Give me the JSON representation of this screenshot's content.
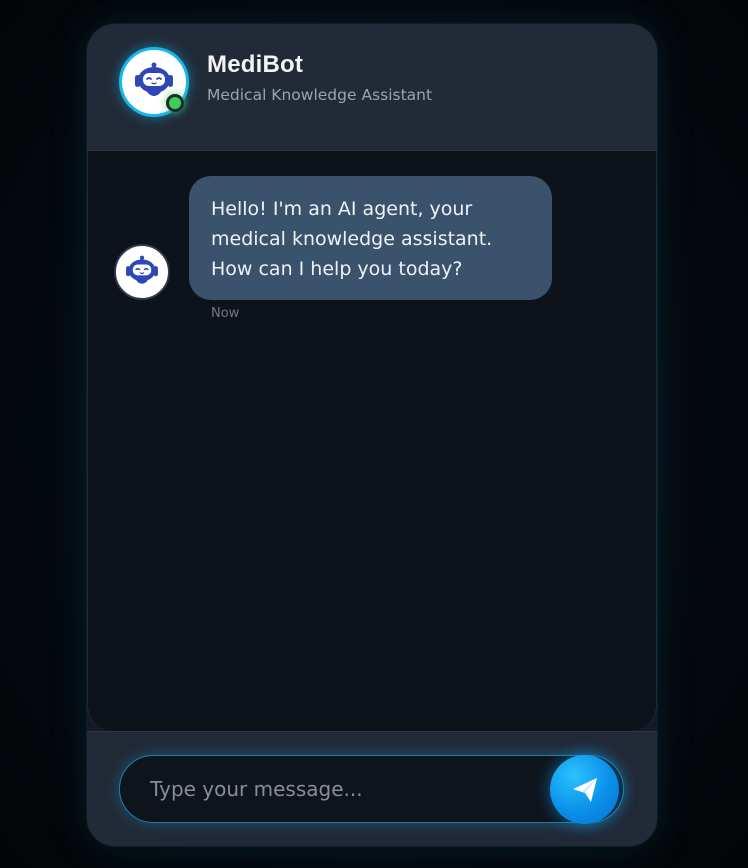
{
  "header": {
    "title": "MediBot",
    "subtitle": "Medical Knowledge Assistant",
    "avatar_icon": "robot-icon",
    "status": "online",
    "status_color": "#3ad152"
  },
  "messages": [
    {
      "sender": "bot",
      "avatar_icon": "robot-icon",
      "text": "Hello! I'm an AI agent, your medical knowledge assistant. How can I help you today?",
      "time": "Now"
    }
  ],
  "composer": {
    "placeholder": "Type your message...",
    "value": "",
    "send_icon": "paper-plane-icon"
  },
  "colors": {
    "accent": "#15b8e8",
    "send_button": "#0a8fe8",
    "bot_bubble": "#3a526b",
    "background": "#0e121a"
  }
}
